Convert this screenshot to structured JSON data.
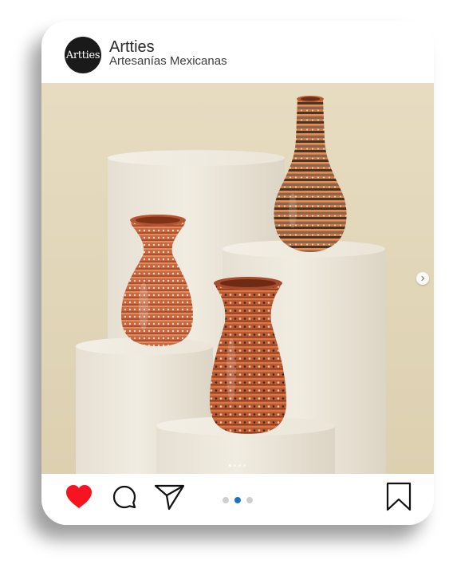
{
  "post": {
    "username": "Artties",
    "subtitle": "Artesanías Mexicanas",
    "avatar_text": "Artties"
  },
  "carousel": {
    "slide_count": 4,
    "active_slide": 1
  },
  "actions": {
    "liked": true,
    "icons": [
      "heart-icon",
      "comment-icon",
      "share-icon",
      "bookmark-icon"
    ],
    "page_dots": 3,
    "active_dot": 2
  },
  "colors": {
    "like": "#f5141f",
    "active_dot": "#1a73c7",
    "backdrop": "#e5d9bd",
    "pottery": "#c4653f"
  }
}
